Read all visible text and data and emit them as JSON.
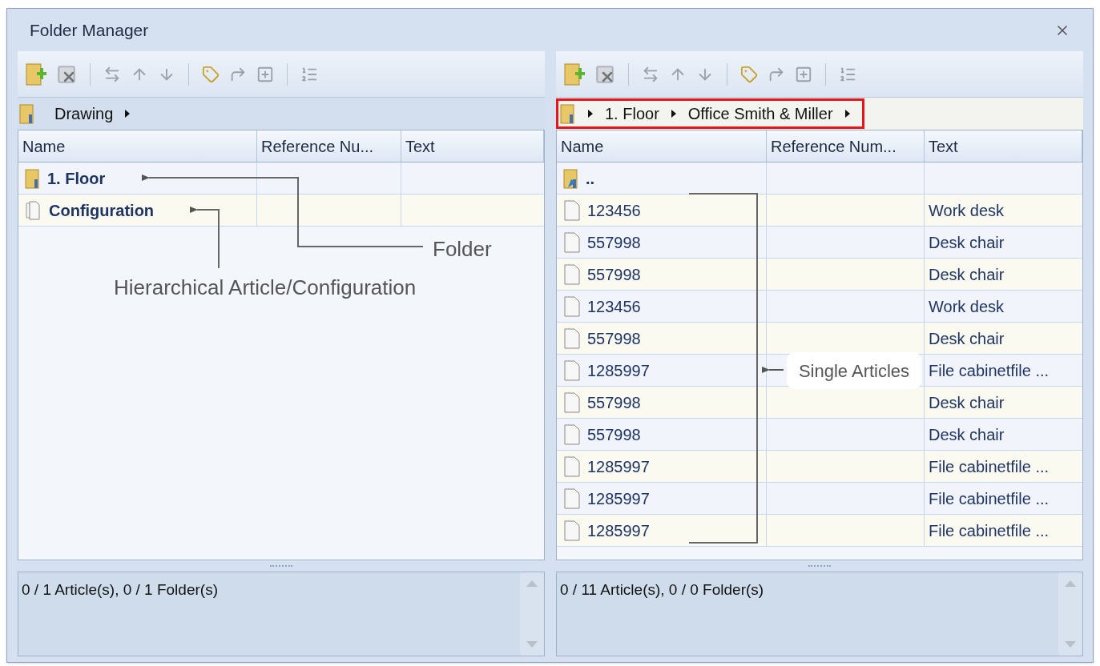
{
  "window": {
    "title": "Folder Manager"
  },
  "panels": [
    {
      "breadcrumb": {
        "highlighted": false,
        "root_label": "Drawing"
      },
      "columns": [
        "Name",
        "Reference Nu...",
        "Text"
      ],
      "rows": [
        {
          "kind": "folder",
          "name": "1. Floor"
        },
        {
          "kind": "configuration",
          "name": "Configuration"
        }
      ],
      "status": "0 / 1 Article(s), 0 / 1 Folder(s)"
    },
    {
      "breadcrumb": {
        "highlighted": true,
        "items": [
          "1. Floor",
          "Office Smith & Miller"
        ]
      },
      "columns": [
        "Name",
        "Reference Num...",
        "Text"
      ],
      "rows": [
        {
          "kind": "up",
          "name": ".."
        },
        {
          "kind": "article",
          "name": "123456",
          "text": "Work desk"
        },
        {
          "kind": "article",
          "name": "557998",
          "text": "Desk chair"
        },
        {
          "kind": "article",
          "name": "557998",
          "text": "Desk chair"
        },
        {
          "kind": "article",
          "name": "123456",
          "text": "Work desk"
        },
        {
          "kind": "article",
          "name": "557998",
          "text": "Desk chair"
        },
        {
          "kind": "article",
          "name": "1285997",
          "text": "File cabinetfile ..."
        },
        {
          "kind": "article",
          "name": "557998",
          "text": "Desk chair"
        },
        {
          "kind": "article",
          "name": "557998",
          "text": "Desk chair"
        },
        {
          "kind": "article",
          "name": "1285997",
          "text": "File cabinetfile ..."
        },
        {
          "kind": "article",
          "name": "1285997",
          "text": "File cabinetfile ..."
        },
        {
          "kind": "article",
          "name": "1285997",
          "text": "File cabinetfile ..."
        }
      ],
      "status": "0 / 11 Article(s), 0 / 0 Folder(s)"
    }
  ],
  "annotations": [
    "Folder",
    "Hierarchical Article/Configuration",
    "Single Articles"
  ]
}
